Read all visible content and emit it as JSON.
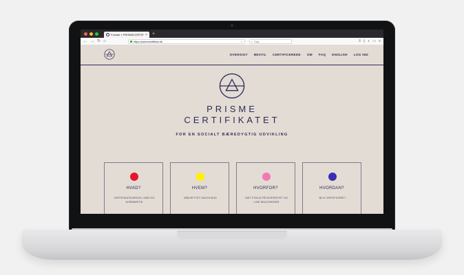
{
  "browser": {
    "tab_title": "Forside « PRISMECERTIFIKATET",
    "tab_close": "×",
    "new_tab": "+",
    "url": "https://primecertifikat.dk",
    "search_placeholder": "Søg"
  },
  "site": {
    "nav": [
      "OVERSIGT",
      "BESTIL",
      "CERTIFICEREDE",
      "OM",
      "FAQ",
      "ENGLISH",
      "LOG IND"
    ],
    "title_line1": "PRISME",
    "title_line2": "CERTIFIKATET",
    "tagline": "FOR EN SOCIALT BÆREDYGTIG UDVIKLING",
    "brand_color": "#2d2a55",
    "background_color": "#e3dcd4"
  },
  "cards": [
    {
      "title": "HVAD?",
      "text": "CERTIFIKATKURSUS I KØN OG NORMKRITIK",
      "dot_color": "#e4162b"
    },
    {
      "title": "HVEM?",
      "text": "MÅLRETTET DAGTILBUD",
      "dot_color": "#fff200"
    },
    {
      "title": "HVORFOR?",
      "text": "SÆT FOKUS PÅ DIVERSITET OG LIGE MULIGHEDER",
      "dot_color": "#f27ab0"
    },
    {
      "title": "HVORDAN?",
      "text": "BLIV CERTIFICERET",
      "dot_color": "#3b2db5"
    }
  ]
}
